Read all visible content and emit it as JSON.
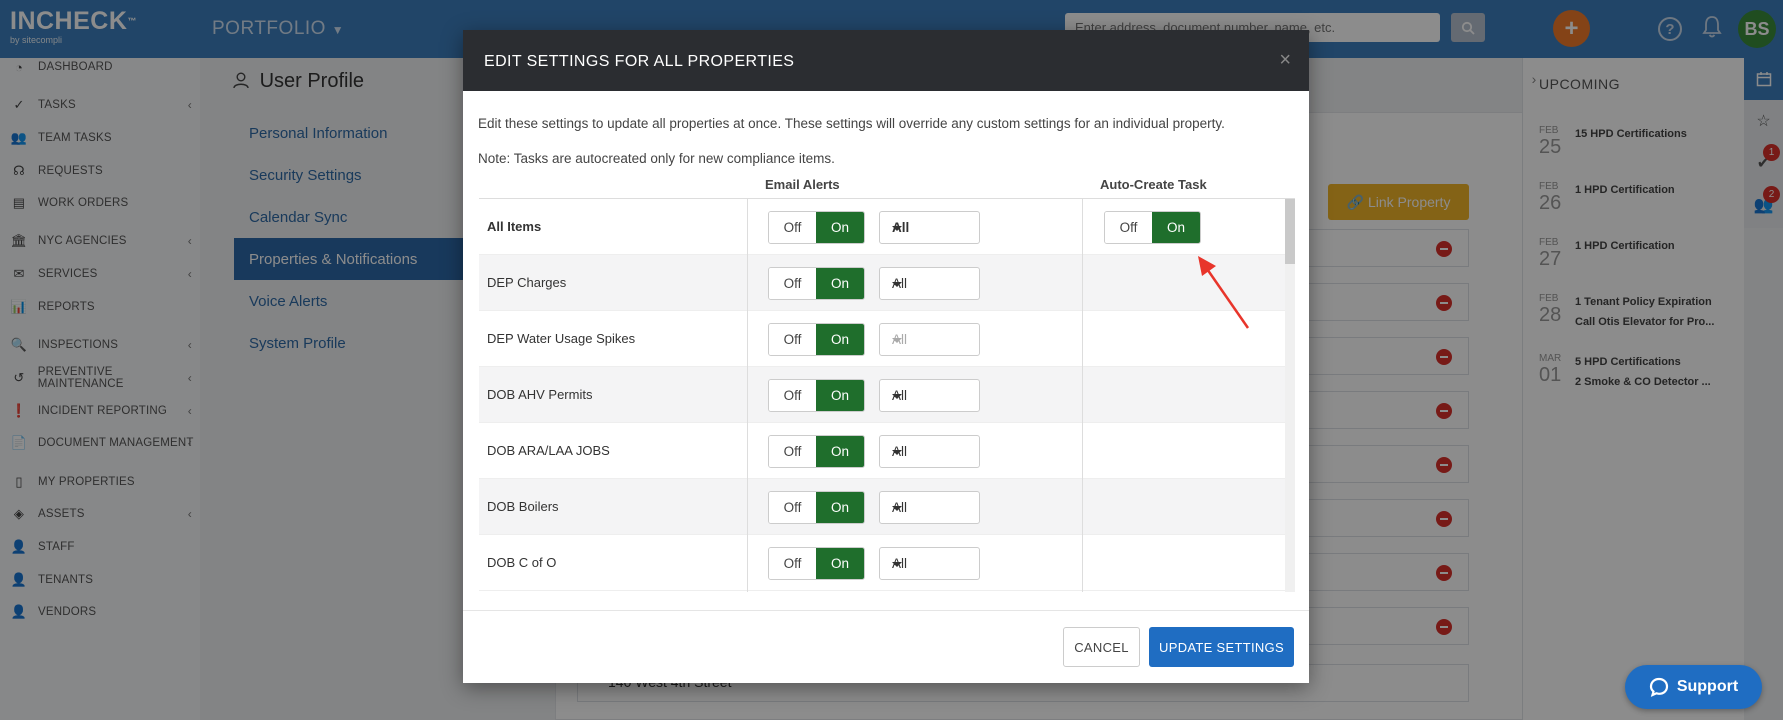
{
  "app": {
    "brand": "INCHECK",
    "brand_tm": "™",
    "by": "by sitecompli",
    "portfolio": "PORTFOLIO",
    "search_placeholder": "Enter address, document number, name, etc.",
    "plus": "+",
    "help": "?",
    "avatar": "BS"
  },
  "sidebar": {
    "items": [
      {
        "label": "DASHBOARD",
        "chevron": false
      },
      {
        "label": "TASKS",
        "chevron": true
      },
      {
        "label": "TEAM TASKS",
        "chevron": false
      },
      {
        "label": "REQUESTS",
        "chevron": false
      },
      {
        "label": "WORK ORDERS",
        "chevron": false
      },
      {
        "label": "NYC AGENCIES",
        "chevron": true
      },
      {
        "label": "SERVICES",
        "chevron": true
      },
      {
        "label": "REPORTS",
        "chevron": false
      },
      {
        "label": "INSPECTIONS",
        "chevron": true
      },
      {
        "label": "PREVENTIVE MAINTENANCE",
        "chevron": true
      },
      {
        "label": "INCIDENT REPORTING",
        "chevron": true
      },
      {
        "label": "DOCUMENT MANAGEMENT",
        "chevron": true
      },
      {
        "label": "MY PROPERTIES",
        "chevron": false
      },
      {
        "label": "ASSETS",
        "chevron": true
      },
      {
        "label": "STAFF",
        "chevron": false
      },
      {
        "label": "TENANTS",
        "chevron": false
      },
      {
        "label": "VENDORS",
        "chevron": false
      }
    ]
  },
  "profile": {
    "title": "User Profile",
    "nav": [
      {
        "label": "Personal Information",
        "active": false
      },
      {
        "label": "Security Settings",
        "active": false
      },
      {
        "label": "Calendar Sync",
        "active": false
      },
      {
        "label": "Properties & Notifications",
        "active": true
      },
      {
        "label": "Voice Alerts",
        "active": false
      },
      {
        "label": "System Profile",
        "active": false
      }
    ],
    "link_property": "Link Property",
    "bg_last_row": "140 West 4th Street"
  },
  "upcoming": {
    "title": "UPCOMING",
    "items": [
      {
        "mon": "FEB",
        "day": "25",
        "t1": "15 HPD Certifications",
        "t2": ""
      },
      {
        "mon": "FEB",
        "day": "26",
        "t1": "1 HPD Certification",
        "t2": ""
      },
      {
        "mon": "FEB",
        "day": "27",
        "t1": "1 HPD Certification",
        "t2": ""
      },
      {
        "mon": "FEB",
        "day": "28",
        "t1": "1 Tenant Policy Expiration",
        "t2": "Call Otis Elevator for Pro..."
      },
      {
        "mon": "MAR",
        "day": "01",
        "t1": "5 HPD Certifications",
        "t2": "2 Smoke & CO Detector ..."
      }
    ],
    "badges": [
      "1",
      "2"
    ]
  },
  "support": {
    "label": "Support"
  },
  "modal": {
    "title": "EDIT SETTINGS FOR ALL PROPERTIES",
    "close": "×",
    "description": "Edit these settings to update all properties at once. These settings will override any custom settings for an individual property.",
    "note": "Note: Tasks are autocreated only for new compliance items.",
    "col_email": "Email Alerts",
    "col_task": "Auto-Create Task",
    "off_label": "Off",
    "on_label": "On",
    "rows": [
      {
        "name": "All Items",
        "email": "on",
        "filter": "All",
        "filter_disabled": false,
        "task": "on"
      },
      {
        "name": "DEP Charges",
        "email": "on",
        "filter": "All",
        "filter_disabled": false,
        "task": null
      },
      {
        "name": "DEP Water Usage Spikes",
        "email": "on",
        "filter": "All",
        "filter_disabled": true,
        "task": null
      },
      {
        "name": "DOB AHV Permits",
        "email": "on",
        "filter": "All",
        "filter_disabled": false,
        "task": null
      },
      {
        "name": "DOB ARA/LAA JOBS",
        "email": "on",
        "filter": "All",
        "filter_disabled": false,
        "task": null
      },
      {
        "name": "DOB Boilers",
        "email": "on",
        "filter": "All",
        "filter_disabled": false,
        "task": null
      },
      {
        "name": "DOB C of O",
        "email": "on",
        "filter": "All",
        "filter_disabled": false,
        "task": null
      }
    ],
    "cancel": "CANCEL",
    "update": "UPDATE SETTINGS"
  },
  "colors": {
    "topbar": "#3d7fbd",
    "on_green": "#1f6e2c",
    "primary": "#1f6dc2",
    "accent_orange": "#f07a2a",
    "annotation_arrow": "#e8352b"
  }
}
